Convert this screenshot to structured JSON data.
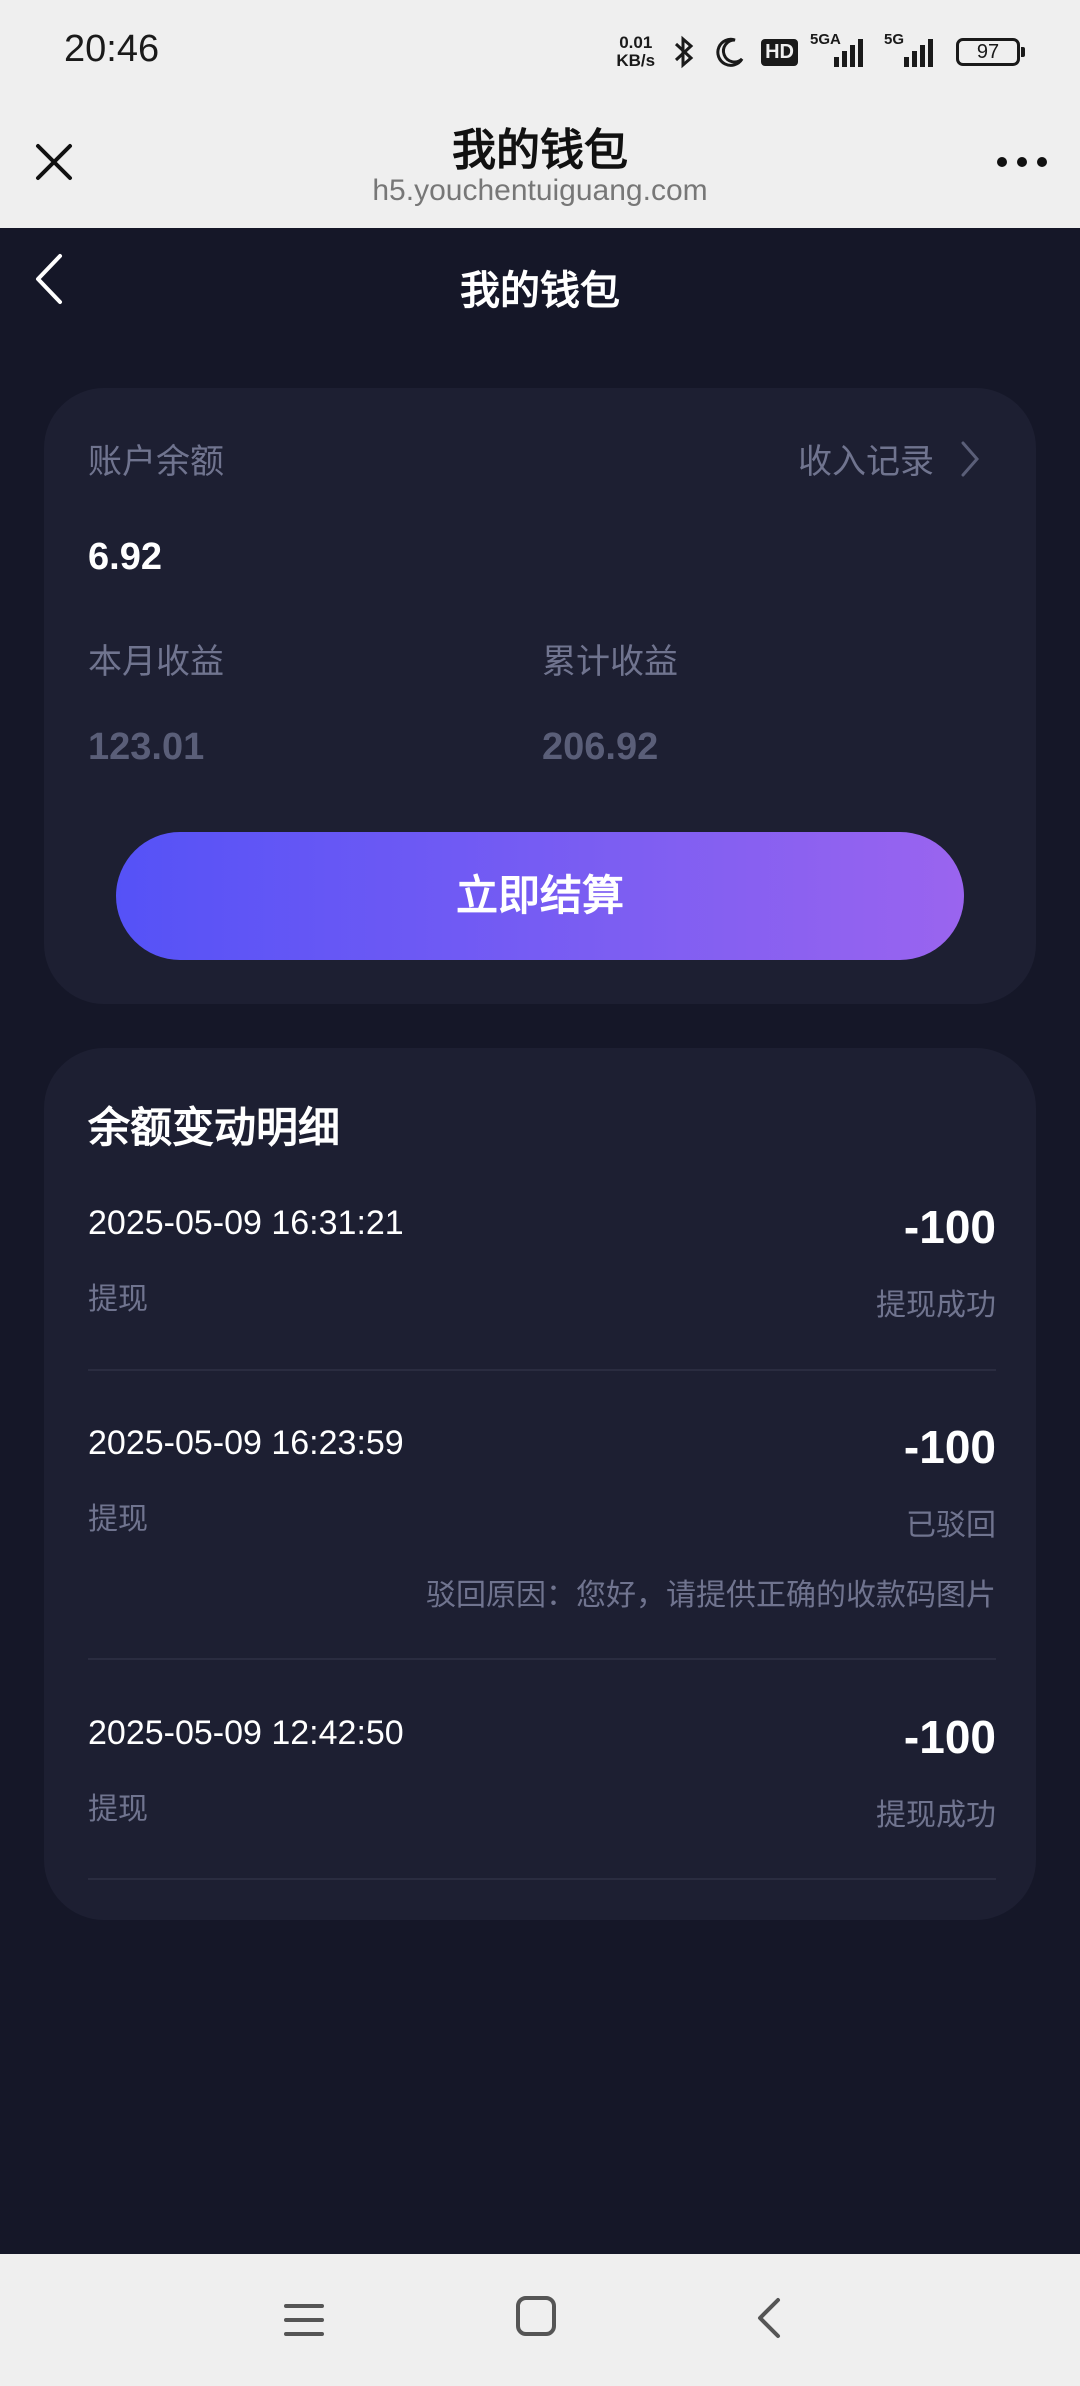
{
  "status_bar": {
    "time": "20:46",
    "net_speed_value": "0.01",
    "net_speed_unit": "KB/s",
    "hd_label": "HD",
    "signal1_label": "5GA",
    "signal2_label": "5G",
    "battery": "97"
  },
  "browser": {
    "title": "我的钱包",
    "url": "h5.youchentuiguang.com"
  },
  "app": {
    "title": "我的钱包"
  },
  "wallet": {
    "balance_label": "账户余额",
    "income_record_label": "收入记录",
    "balance": "6.92",
    "month_label": "本月收益",
    "month_value": "123.01",
    "total_label": "累计收益",
    "total_value": "206.92",
    "settle_button": "立即结算"
  },
  "details": {
    "title": "余额变动明细",
    "records": [
      {
        "datetime": "2025-05-09 16:31:21",
        "type": "提现",
        "amount": "-100",
        "status": "提现成功"
      },
      {
        "datetime": "2025-05-09 16:23:59",
        "type": "提现",
        "amount": "-100",
        "status": "已驳回",
        "reason": "驳回原因：您好，请提供正确的收款码图片"
      },
      {
        "datetime": "2025-05-09 12:42:50",
        "type": "提现",
        "amount": "-100",
        "status": "提现成功"
      }
    ]
  },
  "colors": {
    "page_bg": "#151728",
    "card_bg": "#1d1f32",
    "button_gradient_start": "#5552f7",
    "button_gradient_end": "#9a64ef",
    "muted_text": "#70748f"
  }
}
